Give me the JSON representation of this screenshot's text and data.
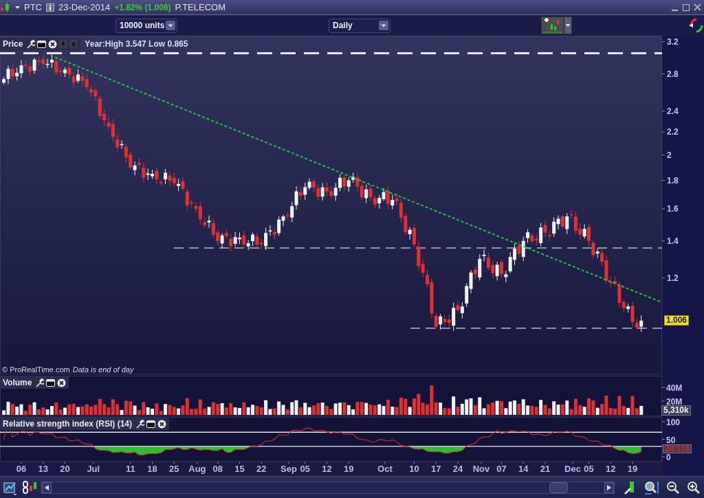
{
  "title_bar": {
    "symbol": "PTC",
    "date": "23-Dec-2014",
    "change": "+1.82% (1.006)",
    "name": "P.TELECOM"
  },
  "toolbar": {
    "units": "10000 units",
    "period": "Daily"
  },
  "price_pane": {
    "title": "Price",
    "year_range": "Year:High 3.547 Low 0.865",
    "last_price": "1.006",
    "copyright": "© ProRealTime.com",
    "note": "Data is end of day",
    "y_axis_labels": [
      "3.2",
      "2.8",
      "2.4",
      "2.2",
      "2",
      "1.8",
      "1.6",
      "1.4",
      "1.2"
    ]
  },
  "x_axis_labels": [
    "06",
    "13",
    "20",
    "Jul",
    "11",
    "18",
    "25",
    "Aug",
    "08",
    "15",
    "22",
    "Sep",
    "05",
    "12",
    "19",
    "Oct",
    "10",
    "17",
    "24",
    "Nov",
    "07",
    "14",
    "21",
    "Dec",
    "05",
    "12",
    "19"
  ],
  "volume_pane": {
    "title": "Volume",
    "axis_labels": [
      "40M",
      "20M"
    ],
    "last_value": "5,310k"
  },
  "rsi_pane": {
    "title": "Relative strength index (RSI) (14)",
    "axis_labels": [
      "100",
      "50",
      "0"
    ],
    "last_value": "28.116"
  }
}
